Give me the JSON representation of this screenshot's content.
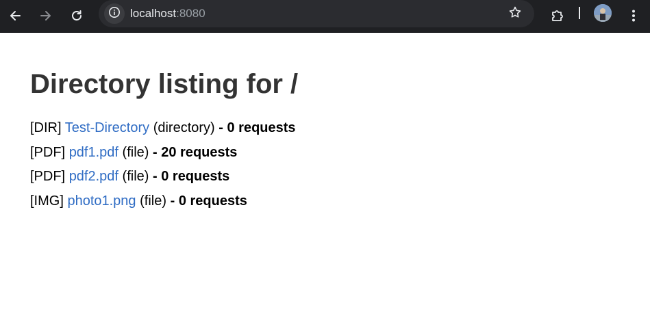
{
  "browser": {
    "url_host": "localhost",
    "url_port": ":8080",
    "colors": {
      "toolbar_bg": "#1f2023",
      "omnibox_bg": "#2b2c30",
      "icon": "#e8eaed",
      "icon_disabled": "#8a8c90"
    }
  },
  "page": {
    "title": "Directory listing for /",
    "link_color": "#2f6cc4",
    "entries": [
      {
        "tag": "[DIR]",
        "name": "Test-Directory",
        "kind": "(directory)",
        "sep": "-",
        "requests": "0 requests"
      },
      {
        "tag": "[PDF]",
        "name": "pdf1.pdf",
        "kind": "(file)",
        "sep": "-",
        "requests": "20 requests"
      },
      {
        "tag": "[PDF]",
        "name": "pdf2.pdf",
        "kind": "(file)",
        "sep": "-",
        "requests": "0 requests"
      },
      {
        "tag": "[IMG]",
        "name": "photo1.png",
        "kind": "(file)",
        "sep": "-",
        "requests": "0 requests"
      }
    ]
  }
}
